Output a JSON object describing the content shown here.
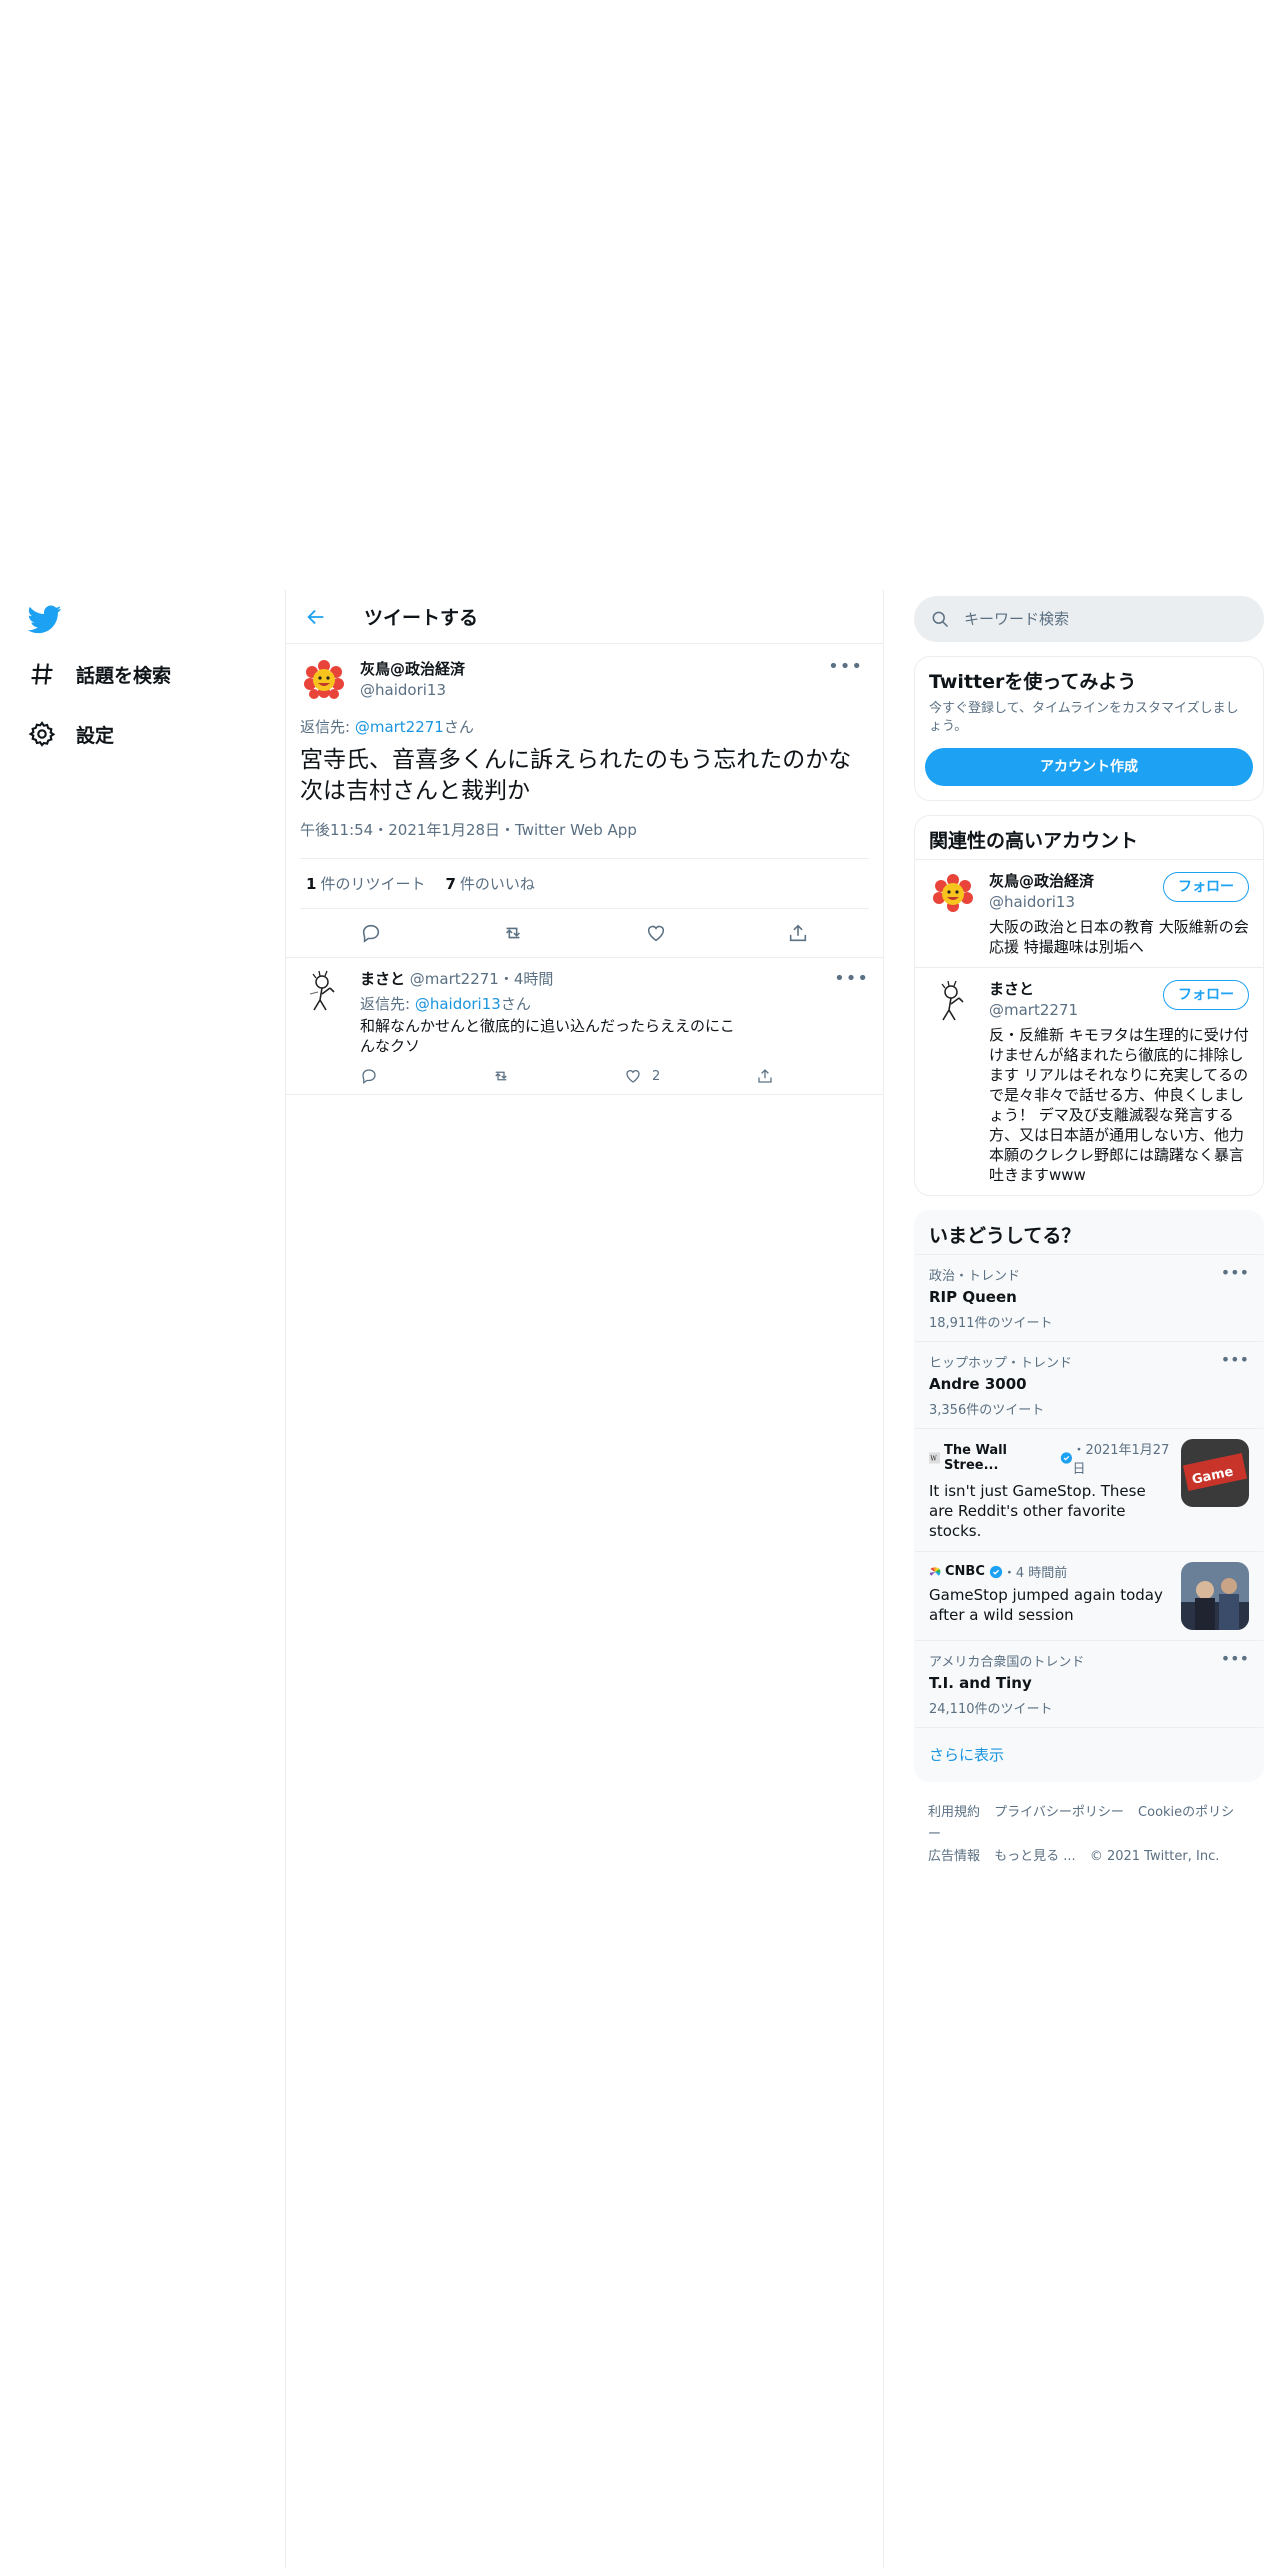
{
  "nav": {
    "items": [
      {
        "label": "話題を検索"
      },
      {
        "label": "設定"
      }
    ]
  },
  "main": {
    "title": "ツイートする",
    "tweet": {
      "author_name": "灰鳥@政治経済",
      "author_handle": "@haidori13",
      "reply_prefix": "返信先: ",
      "reply_handle": "@mart2271",
      "reply_suffix": "さん",
      "text_line1": "宮寺氏、音喜多くんに訴えられたのもう忘れたのかな",
      "text_line2": "次は吉村さんと裁判か",
      "meta": "午後11:54・2021年1月28日・Twitter Web App",
      "retweets_num": "1",
      "retweets_label": "件のリツイート",
      "likes_num": "7",
      "likes_label": "件のいいね"
    },
    "reply": {
      "name": "まさと",
      "handle": "@mart2271",
      "time": "・4時間",
      "reply_prefix": "返信先: ",
      "reply_handle": "@haidori13",
      "reply_suffix": "さん",
      "text": "和解なんかせんと徹底的に追い込んだったらええのにこんなクソ",
      "like_count": "2"
    }
  },
  "sidebar": {
    "search_placeholder": "キーワード検索",
    "signup": {
      "title": "Twitterを使ってみよう",
      "desc": "今すぐ登録して、タイムラインをカスタマイズしましょう。",
      "button": "アカウント作成"
    },
    "related": {
      "title": "関連性の高いアカウント",
      "follow_label": "フォロー",
      "accounts": [
        {
          "name": "灰鳥@政治経済",
          "handle": "@haidori13",
          "bio": "大阪の政治と日本の教育 大阪維新の会応援 特撮趣味は別垢へ"
        },
        {
          "name": "まさと",
          "handle": "@mart2271",
          "bio": "反・反維新 キモヲタは生理的に受け付けませんが絡まれたら徹底的に排除します リアルはそれなりに充実してるので是々非々で話せる方、仲良くしましょう！ デマ及び支離滅裂な発言する方、又は日本語が通用しない方、他力本願のクレクレ野郎には躊躇なく暴言吐きますwww"
        }
      ]
    },
    "trends": {
      "title": "いまどうしてる？",
      "items": [
        {
          "context": "政治・トレンド",
          "name": "RIP Queen",
          "count": "18,911件のツイート"
        },
        {
          "context": "ヒップホップ・トレンド",
          "name": "Andre 3000",
          "count": "3,356件のツイート"
        },
        {
          "context": "アメリカ合衆国のトレンド",
          "name": "T.I. and Tiny",
          "count": "24,110件のツイート"
        }
      ],
      "news": [
        {
          "source": "The Wall Stree...",
          "time": "・2021年1月27日",
          "title": "It isn't just GameStop. These are Reddit's other favorite stocks."
        },
        {
          "source": "CNBC",
          "time": "・4 時間前",
          "title": "GameStop jumped again today after a wild session"
        }
      ],
      "show_more": "さらに表示"
    },
    "footer": {
      "links": [
        "利用規約",
        "プライバシーポリシー",
        "Cookieのポリシー",
        "広告情報",
        "もっと見る ...",
        "© 2021 Twitter, Inc."
      ]
    }
  },
  "colors": {
    "accent": "#1da1f2",
    "link": "#1b95e0",
    "muted": "#5b7083",
    "border": "#ebeef0"
  }
}
